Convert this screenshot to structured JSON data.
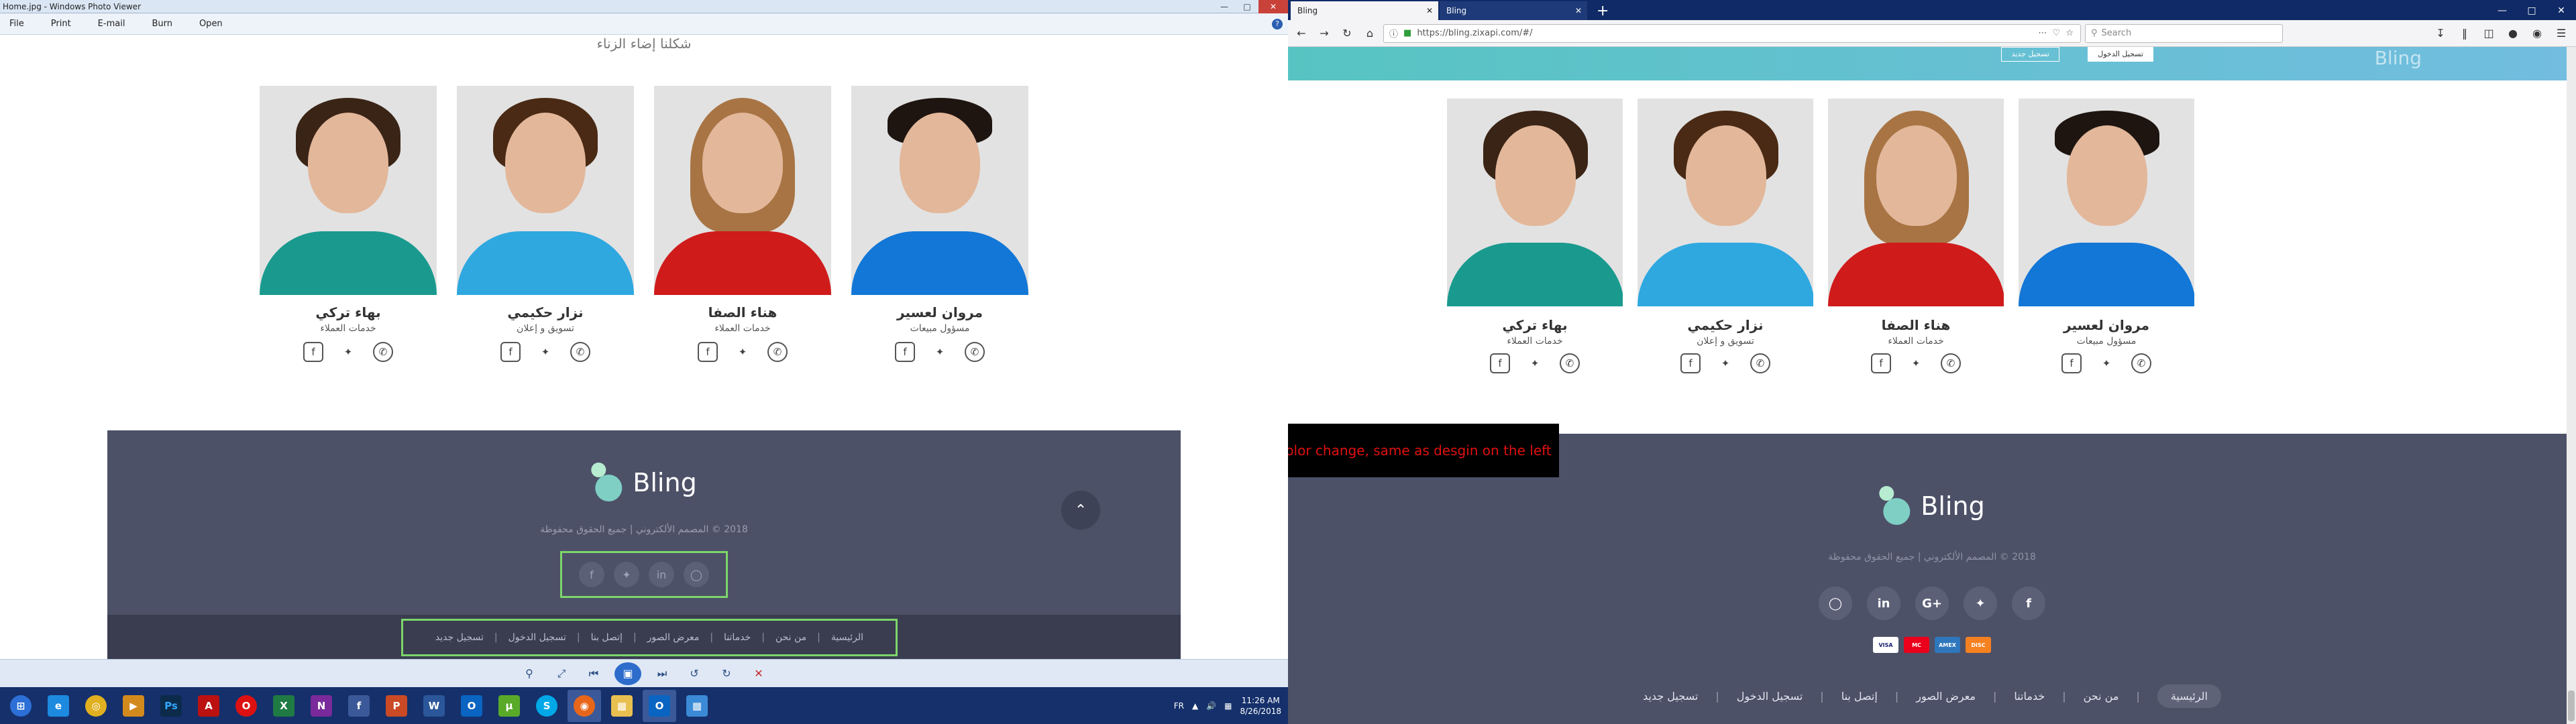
{
  "photo_viewer": {
    "title": "Home.jpg - Windows Photo Viewer",
    "menu": [
      "File",
      "Print",
      "E-mail",
      "Burn",
      "Open"
    ],
    "help": "?",
    "heading_cut": "شكلنا إضاء الزناء",
    "team": [
      {
        "name": "بهاء تركي",
        "role": "خدمات العملاء"
      },
      {
        "name": "نزار حكيمي",
        "role": "تسويق و إعلان"
      },
      {
        "name": "هناء الصفا",
        "role": "خدمات العملاء"
      },
      {
        "name": "مروان لعسير",
        "role": "مسؤول مبيعات"
      }
    ],
    "footer": {
      "logo_text": "Bling",
      "copyright": "2018 © المصمم الألكتروني | جميع الحقوق محفوظة",
      "nav": [
        "الرئيسية",
        "من نحن",
        "خدماتنا",
        "معرض الصور",
        "إتصل بنا",
        "تسجيل الدخول",
        "تسجيل جديد"
      ]
    }
  },
  "taskbar": {
    "lang": "FR",
    "time": "11:26 AM",
    "date": "8/26/2018"
  },
  "browser": {
    "tabs": [
      "Bling",
      "Bling"
    ],
    "url": "https://bling.zixapi.com/#/",
    "search_placeholder": "Search",
    "hero_buttons": [
      "تسجيل الدخول",
      "تسجيل جديد"
    ],
    "hero_logo_ghost": "Bling",
    "team": [
      {
        "name": "بهاء تركي",
        "role": "خدمات العملاء"
      },
      {
        "name": "نزار حكيمي",
        "role": "تسويق و إعلان"
      },
      {
        "name": "هناء الصفا",
        "role": "خدمات العملاء"
      },
      {
        "name": "مروان لعسير",
        "role": "مسؤول مبيعات"
      }
    ],
    "note": "color change, same as desgin on the left",
    "footer": {
      "logo_text": "Bling",
      "copyright": "2018 © المصمم الألكتروني | جميع الحقوق محفوظة",
      "payment_cards": [
        "VISA",
        "MC",
        "AMEX",
        "DISC"
      ],
      "nav": [
        "الرئيسية",
        "من نحن",
        "خدماتنا",
        "معرض الصور",
        "إتصل بنا",
        "تسجيل الدخول",
        "تسجيل جديد"
      ]
    }
  },
  "colors": {
    "footer_bg": "#4d5167",
    "nav_bg": "#3a3d4f",
    "highlight_border": "#7dd56b",
    "note_text": "#e01010",
    "hero_gradient_start": "#57c4c2",
    "hero_gradient_end": "#72bde0"
  }
}
